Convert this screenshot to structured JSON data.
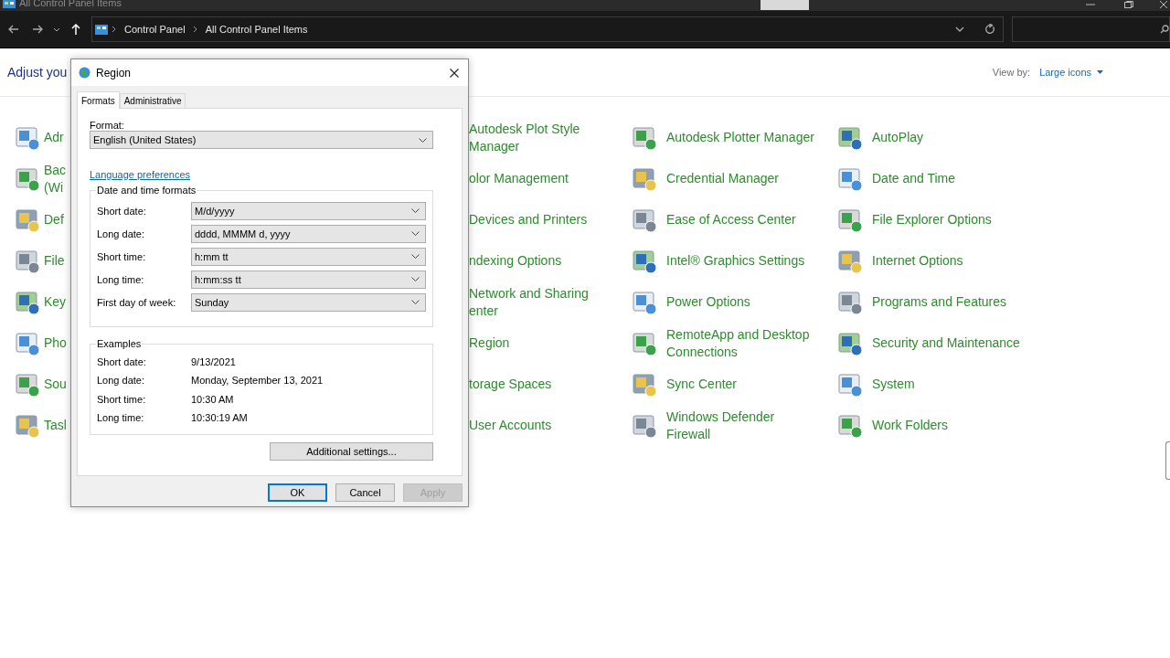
{
  "window": {
    "title": "All Control Panel Items"
  },
  "nav": {
    "path": [
      "Control Panel",
      "All Control Panel Items"
    ]
  },
  "content": {
    "heading": "Adjust you",
    "view_by_label": "View by:",
    "view_by_value": "Large icons",
    "columns": [
      {
        "icons": true,
        "items": [
          {
            "label": "Adr"
          },
          {
            "label": "Bac\n(Wi"
          },
          {
            "label": "Def"
          },
          {
            "label": "File"
          },
          {
            "label": "Key"
          },
          {
            "label": "Pho"
          },
          {
            "label": "Sou"
          },
          {
            "label": "Tasl"
          }
        ]
      },
      {
        "icons": false,
        "items": [
          {
            "label": "Autodesk Plot Style\nManager"
          },
          {
            "label": "olor Management"
          },
          {
            "label": "Devices and Printers"
          },
          {
            "label": "ndexing Options"
          },
          {
            "label": "Network and Sharing\nenter"
          },
          {
            "label": "Region"
          },
          {
            "label": "torage Spaces"
          },
          {
            "label": "User Accounts"
          }
        ]
      },
      {
        "icons": true,
        "items": [
          {
            "label": "Autodesk Plotter Manager"
          },
          {
            "label": "Credential Manager"
          },
          {
            "label": "Ease of Access Center"
          },
          {
            "label": "Intel® Graphics Settings"
          },
          {
            "label": "Power Options"
          },
          {
            "label": "RemoteApp and Desktop\nConnections"
          },
          {
            "label": "Sync Center"
          },
          {
            "label": "Windows Defender\nFirewall"
          }
        ]
      },
      {
        "icons": true,
        "items": [
          {
            "label": "AutoPlay"
          },
          {
            "label": "Date and Time"
          },
          {
            "label": "File Explorer Options"
          },
          {
            "label": "Internet Options"
          },
          {
            "label": "Programs and Features"
          },
          {
            "label": "Security and Maintenance"
          },
          {
            "label": "System"
          },
          {
            "label": "Work Folders"
          }
        ]
      }
    ]
  },
  "dialog": {
    "title": "Region",
    "tabs": [
      {
        "label": "Formats",
        "selected": true
      },
      {
        "label": "Administrative",
        "selected": false
      }
    ],
    "format_label": "Format:",
    "format_value": "English (United States)",
    "link": "Language preferences",
    "formats_group": "Date and time formats",
    "formats": [
      {
        "label": "Short date:",
        "value": "M/d/yyyy"
      },
      {
        "label": "Long date:",
        "value": "dddd, MMMM d, yyyy"
      },
      {
        "label": "Short time:",
        "value": "h:mm tt"
      },
      {
        "label": "Long time:",
        "value": "h:mm:ss tt"
      },
      {
        "label": "First day of week:",
        "value": "Sunday"
      }
    ],
    "examples_group": "Examples",
    "examples": [
      {
        "label": "Short date:",
        "value": "9/13/2021"
      },
      {
        "label": "Long date:",
        "value": "Monday, September 13, 2021"
      },
      {
        "label": "Short time:",
        "value": "10:30 AM"
      },
      {
        "label": "Long time:",
        "value": "10:30:19 AM"
      }
    ],
    "additional": "Additional settings...",
    "buttons": [
      {
        "label": "OK",
        "default": true,
        "disabled": false
      },
      {
        "label": "Cancel",
        "default": false,
        "disabled": false
      },
      {
        "label": "Apply",
        "default": false,
        "disabled": true
      }
    ]
  }
}
